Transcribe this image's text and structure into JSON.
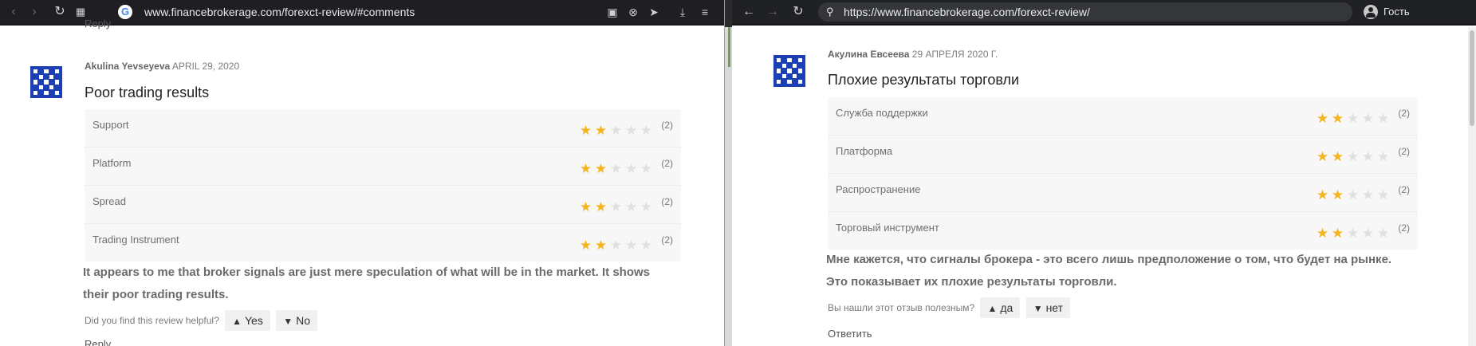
{
  "left_window": {
    "url": "www.financebrokerage.com/forexct-review/#comments",
    "reply_top_label": "Reply",
    "review": {
      "author": "Akulina Yevseyeva",
      "date": "APRIL 29, 2020",
      "title": "Poor trading results",
      "ratings": [
        {
          "label": "Support",
          "stars": 2,
          "count": "(2)"
        },
        {
          "label": "Platform",
          "stars": 2,
          "count": "(2)"
        },
        {
          "label": "Spread",
          "stars": 2,
          "count": "(2)"
        },
        {
          "label": "Trading Instrument",
          "stars": 2,
          "count": "(2)"
        }
      ],
      "text": "It appears to me that broker signals are just mere speculation of what will be in the market. It shows their poor trading results.",
      "helpful_question": "Did you find this review helpful?",
      "yes_label": "Yes",
      "no_label": "No",
      "reply_label": "Reply"
    }
  },
  "right_window": {
    "url": "https://www.financebrokerage.com/forexct-review/",
    "profile_label": "Гость",
    "review": {
      "author": "Акулина Евсеева",
      "date": "29 АПРЕЛЯ 2020 Г.",
      "title": "Плохие результаты торговли",
      "ratings": [
        {
          "label": "Служба поддержки",
          "stars": 2,
          "count": "(2)"
        },
        {
          "label": "Платформа",
          "stars": 2,
          "count": "(2)"
        },
        {
          "label": "Распространение",
          "stars": 2,
          "count": "(2)"
        },
        {
          "label": "Торговый инструмент",
          "stars": 2,
          "count": "(2)"
        }
      ],
      "text": "Мне кажется, что сигналы брокера - это всего лишь предположение о том, что будет на рынке. Это показывает их плохие результаты торговли.",
      "helpful_question": "Вы нашли этот отзыв полезным?",
      "yes_label": "да",
      "no_label": "нет",
      "reply_label": "Ответить"
    }
  },
  "colors": {
    "star_on": "#f4b321",
    "star_off": "#e0e0e0",
    "avatar": "#1d3fb4"
  }
}
